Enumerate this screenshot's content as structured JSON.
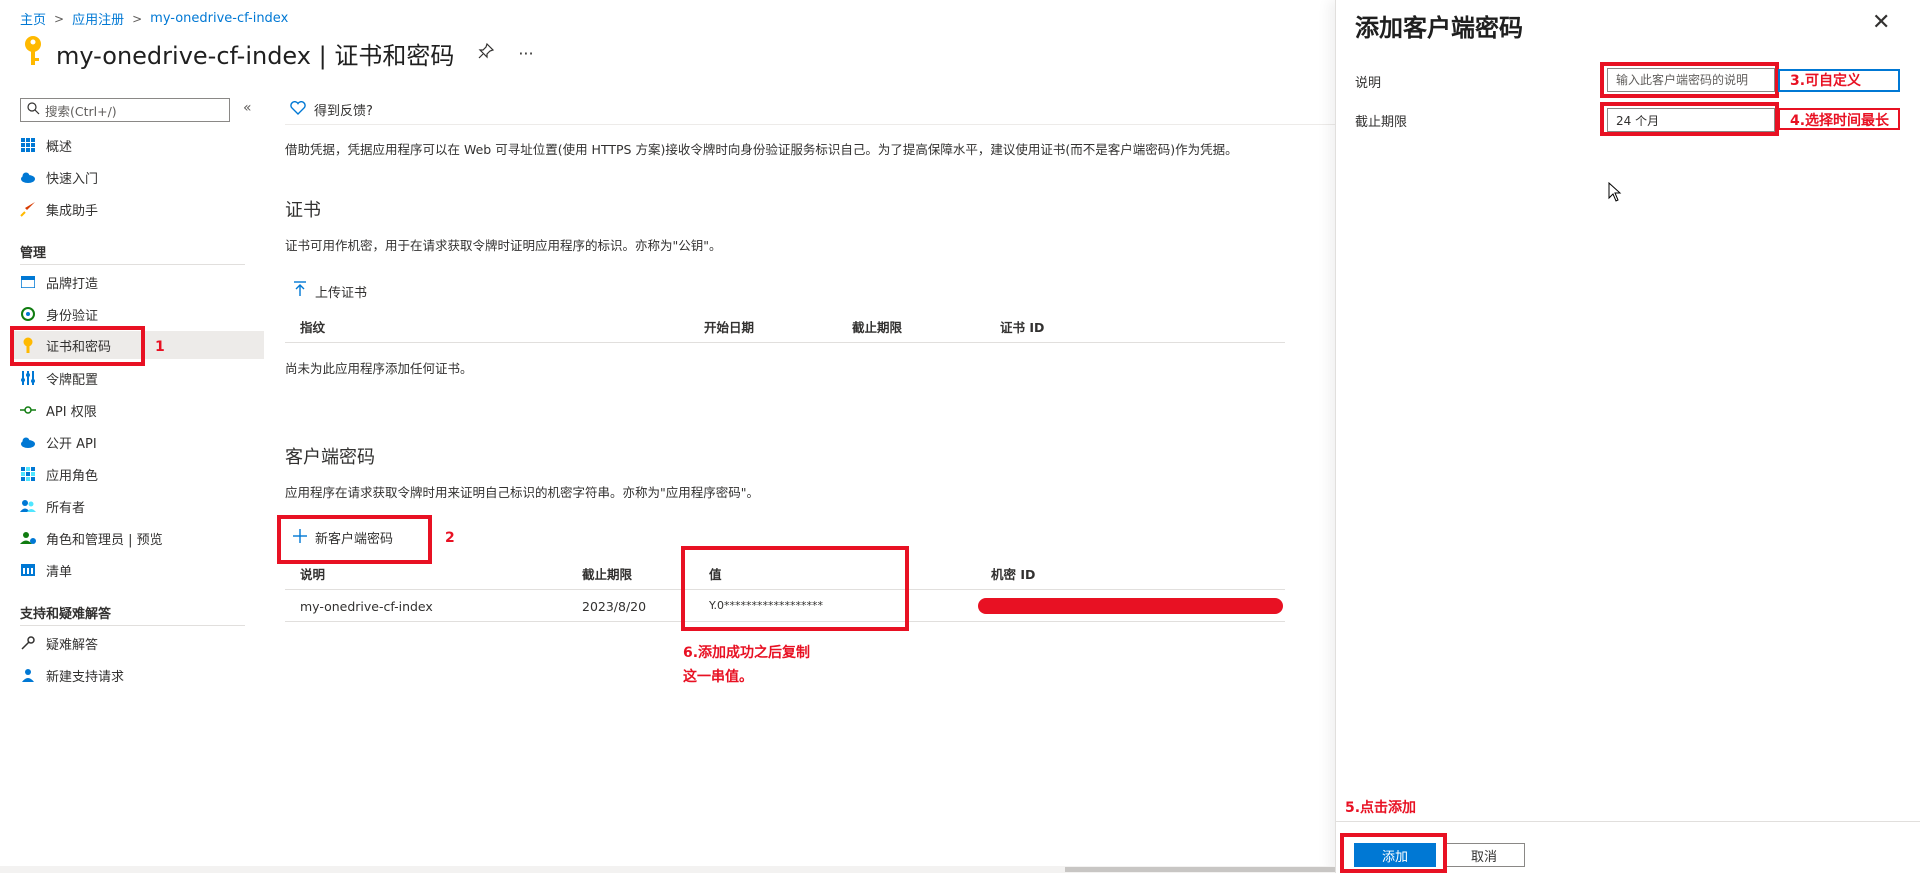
{
  "breadcrumb": {
    "home": "主页",
    "app_reg": "应用注册",
    "app": "my-onedrive-cf-index",
    "sep": ">"
  },
  "page": {
    "title": "my-onedrive-cf-index | 证书和密码",
    "pin": "⚲",
    "more": "···"
  },
  "sidebar": {
    "search_placeholder": "搜索(Ctrl+/)",
    "collapse": "«",
    "items_top": [
      {
        "label": "概述",
        "icon": "grid-icon",
        "color": "#0078d4"
      },
      {
        "label": "快速入门",
        "icon": "cloud-icon",
        "color": "#0078d4"
      },
      {
        "label": "集成助手",
        "icon": "rocket-icon",
        "color": "#d83b01"
      }
    ],
    "manage_heading": "管理",
    "items_manage": [
      {
        "label": "品牌打造",
        "icon": "branding-icon",
        "color": "#0078d4"
      },
      {
        "label": "身份验证",
        "icon": "auth-icon",
        "color": "#107c10"
      },
      {
        "label": "证书和密码",
        "icon": "key-icon",
        "color": "#ffb900",
        "active": true
      },
      {
        "label": "令牌配置",
        "icon": "token-icon",
        "color": "#0078d4"
      },
      {
        "label": "API 权限",
        "icon": "api-icon",
        "color": "#107c10"
      },
      {
        "label": "公开 API",
        "icon": "cloud-api-icon",
        "color": "#0078d4"
      },
      {
        "label": "应用角色",
        "icon": "roles-icon",
        "color": "#0078d4"
      },
      {
        "label": "所有者",
        "icon": "owners-icon",
        "color": "#0078d4"
      },
      {
        "label": "角色和管理员 | 预览",
        "icon": "admin-icon",
        "color": "#107c10"
      },
      {
        "label": "清单",
        "icon": "manifest-icon",
        "color": "#0078d4"
      }
    ],
    "support_heading": "支持和疑难解答",
    "items_support": [
      {
        "label": "疑难解答",
        "icon": "wrench-icon",
        "color": "#323130"
      },
      {
        "label": "新建支持请求",
        "icon": "support-icon",
        "color": "#0078d4"
      }
    ]
  },
  "main": {
    "feedback": "得到反馈?",
    "intro": "借助凭据，凭据应用程序可以在 Web 可寻址位置(使用 HTTPS 方案)接收令牌时向身份验证服务标识自己。为了提高保障水平，建议使用证书(而不是客户端密码)作为凭据。",
    "cert": {
      "heading": "证书",
      "desc": "证书可用作机密，用于在请求获取令牌时证明应用程序的标识。亦称为\"公钥\"。",
      "upload": "上传证书",
      "columns": [
        "指纹",
        "开始日期",
        "截止期限",
        "证书 ID"
      ],
      "empty": "尚未为此应用程序添加任何证书。"
    },
    "secret": {
      "heading": "客户端密码",
      "desc": "应用程序在请求获取令牌时用来证明自己标识的机密字符串。亦称为\"应用程序密码\"。",
      "new": "新客户端密码",
      "columns": [
        "说明",
        "截止期限",
        "值",
        "机密 ID"
      ],
      "row": {
        "desc": "my-onedrive-cf-index",
        "expires": "2023/8/20",
        "value": "Y.0******************"
      }
    }
  },
  "panel": {
    "title": "添加客户端密码",
    "close": "✕",
    "desc_label": "说明",
    "desc_placeholder": "输入此客户端密码的说明",
    "expiry_label": "截止期限",
    "expiry_value": "24 个月",
    "add": "添加",
    "cancel": "取消"
  },
  "annotations": {
    "n1": "1",
    "n2": "2",
    "n3": "3.可自定义",
    "n4": "4.选择时间最长",
    "n5": "5.点击添加",
    "n6_line1": "6.添加成功之后复制",
    "n6_line2": "这一串值。"
  },
  "colors": {
    "accent": "#0078d4",
    "annotation": "#e81123"
  }
}
